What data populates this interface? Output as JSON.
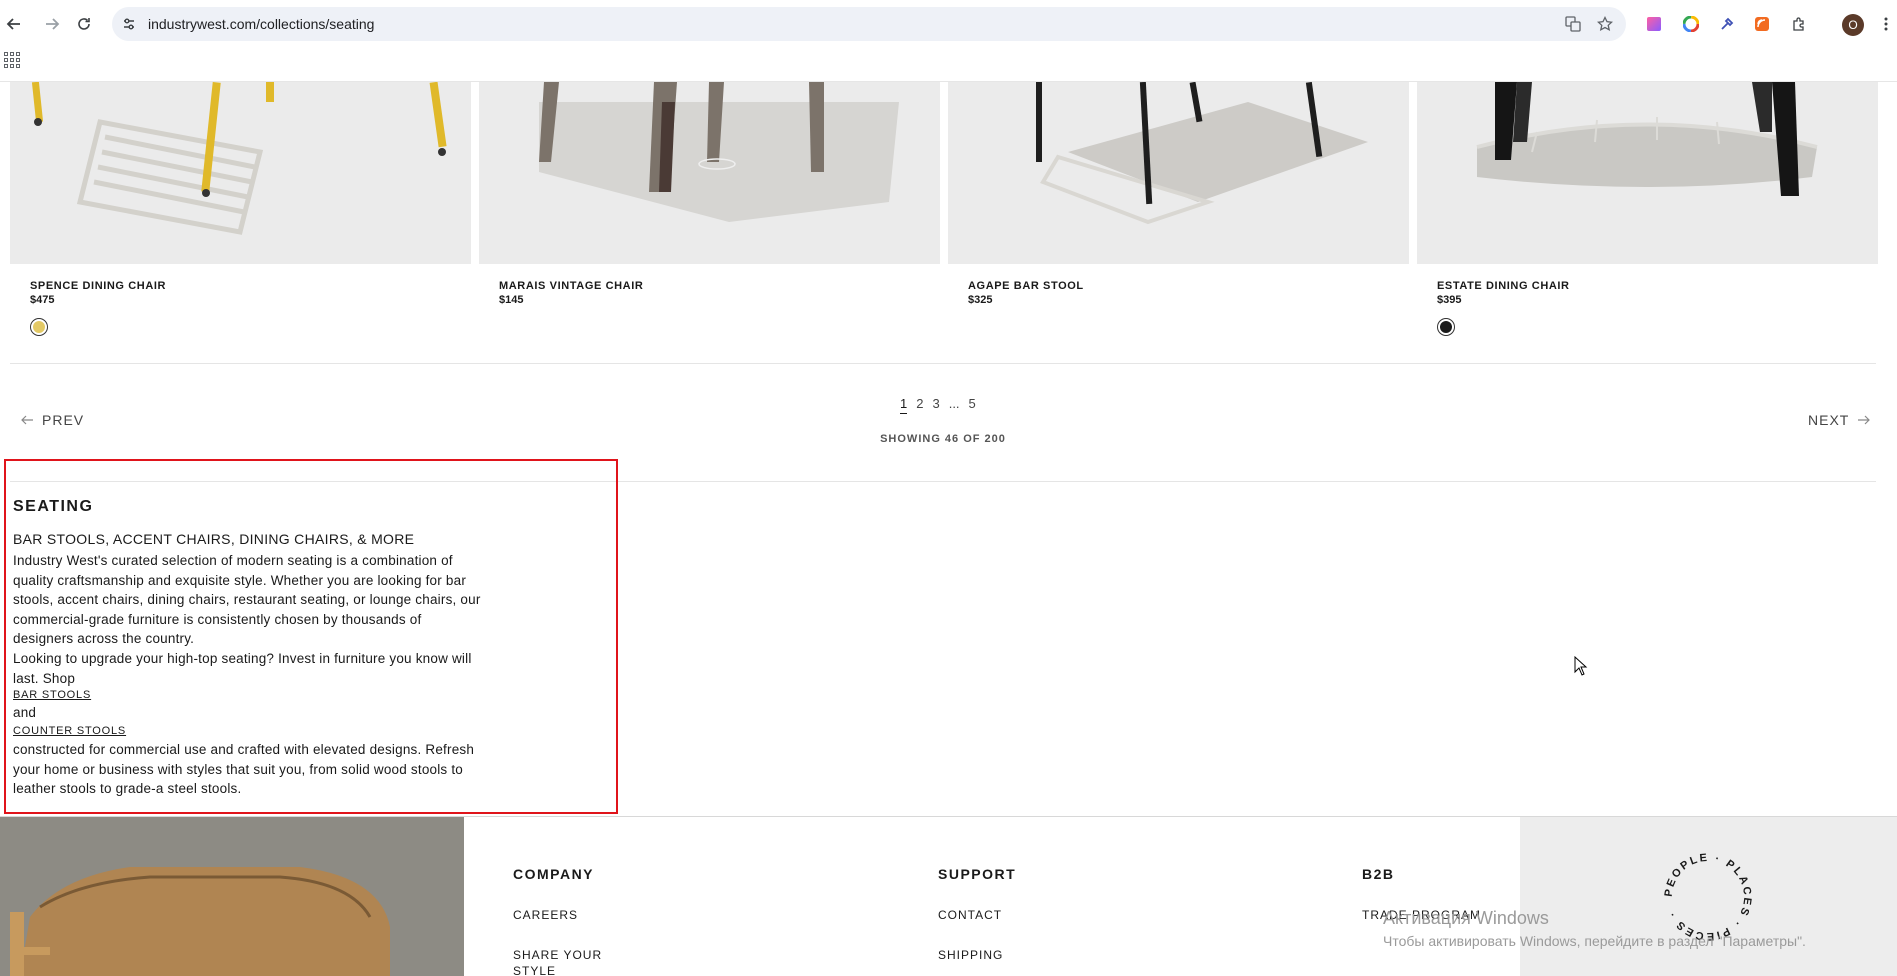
{
  "browser": {
    "url": "industrywest.com/collections/seating",
    "profile_initial": "O"
  },
  "products": [
    {
      "name": "SPENCE DINING CHAIR",
      "price": "$475",
      "swatch_color": "#e3c965"
    },
    {
      "name": "MARAIS VINTAGE CHAIR",
      "price": "$145"
    },
    {
      "name": "AGAPE BAR STOOL",
      "price": "$325"
    },
    {
      "name": "ESTATE DINING CHAIR",
      "price": "$395",
      "swatch_color": "#1a1a1a"
    }
  ],
  "pagination": {
    "prev_label": "PREV",
    "next_label": "NEXT",
    "pages": [
      "1",
      "2",
      "3",
      "...",
      "5"
    ],
    "active_page": "1",
    "showing": "SHOWING 46 OF 200"
  },
  "seo": {
    "title": "SEATING",
    "subtitle": "BAR STOOLS, ACCENT CHAIRS, DINING CHAIRS, & MORE",
    "para1_lines": [
      "Industry West's curated selection of modern seating is a combination of",
      "quality craftsmanship and exquisite style. Whether you are looking for bar",
      "stools, accent chairs, dining chairs, restaurant seating, or lounge chairs, our",
      "commercial-grade furniture is consistently chosen by thousands of",
      "designers across the country."
    ],
    "para2_lines": [
      "Looking to upgrade your high-top seating? Invest in furniture you know will",
      "last. Shop"
    ],
    "link1": "BAR STOOLS",
    "and_text": "and",
    "link2": "COUNTER STOOLS",
    "para3_lines": [
      "constructed for commercial use and crafted with elevated designs. Refresh",
      "your home or business with styles that suit you, from solid wood stools to",
      "leather stools to grade-a steel stools."
    ]
  },
  "footer": {
    "company": {
      "heading": "COMPANY",
      "links": [
        "CAREERS",
        "SHARE YOUR STYLE"
      ]
    },
    "support": {
      "heading": "SUPPORT",
      "links": [
        "CONTACT",
        "SHIPPING"
      ]
    },
    "b2b": {
      "heading": "B2B",
      "links": [
        "TRADE PROGRAM"
      ]
    },
    "badge_text": "PEOPLE · PLACES · PIECES ·"
  },
  "windows_watermark": {
    "title": "Активация Windows",
    "subtitle": "Чтобы активировать Windows, перейдите в раздел \"Параметры\"."
  }
}
